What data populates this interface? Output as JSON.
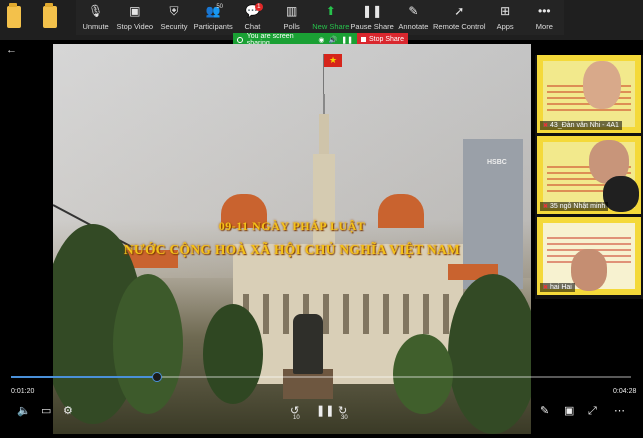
{
  "toolbar": {
    "unmute": "Unmute",
    "stop_video": "Stop Video",
    "security": "Security",
    "participants": "Participants",
    "participants_count": "50",
    "chat": "Chat",
    "chat_badge": "1",
    "polls": "Polls",
    "new_share": "New Share",
    "pause_share": "Pause Share",
    "annotate": "Annotate",
    "remote_control": "Remote Control",
    "apps": "Apps",
    "more": "More"
  },
  "share_bar": {
    "status": "You are screen sharing",
    "stop": "Stop Share"
  },
  "video": {
    "title_line1": "09-11 NGÀY PHÁP LUẬT",
    "title_line2": "NƯỚC CỘNG HOÀ XÃ HỘI CHỦ NGHĨA VIỆT NAM",
    "building_sign": "HSBC",
    "time_elapsed": "0:01:20",
    "time_total": "0:04:28",
    "progress": 0.235,
    "skip_back": "10",
    "skip_forward": "30"
  },
  "participants": [
    {
      "name": "43_Đàn văn Nhi - 4A1"
    },
    {
      "name": "35 ngô Nhật minh"
    },
    {
      "name": "hai Hai"
    }
  ]
}
